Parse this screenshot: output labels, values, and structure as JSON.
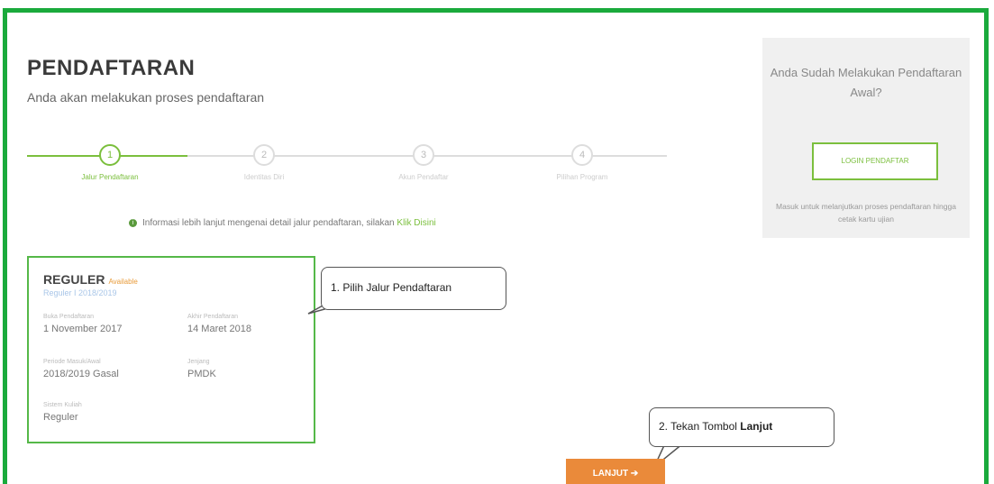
{
  "page": {
    "title": "PENDAFTARAN",
    "subtitle": "Anda akan melakukan proses pendaftaran"
  },
  "steps": [
    {
      "number": "1",
      "label": "Jalur Pendaftaran",
      "active": true
    },
    {
      "number": "2",
      "label": "Identitas Diri",
      "active": false
    },
    {
      "number": "3",
      "label": "Akun Pendaftar",
      "active": false
    },
    {
      "number": "4",
      "label": "Pilihan Program",
      "active": false
    }
  ],
  "info": {
    "text": "Informasi lebih lanjut mengenai detail jalur pendaftaran, silakan",
    "link_label": "Klik Disini"
  },
  "sidebar": {
    "question": "Anda Sudah Melakukan Pendaftaran Awal?",
    "login_button": "LOGIN PENDAFTAR",
    "note": "Masuk untuk melanjutkan proses pendaftaran hingga cetak kartu ujian"
  },
  "card": {
    "name": "REGULER",
    "badge": "Available",
    "period": "Reguler I 2018/2019",
    "fields": [
      {
        "label": "Buka Pendaftaran",
        "value": "1 November 2017"
      },
      {
        "label": "Akhir Pendaftaran",
        "value": "14 Maret 2018"
      },
      {
        "label": "Periode Masuk/Awal",
        "value": "2018/2019 Gasal"
      },
      {
        "label": "Jenjang",
        "value": "PMDK"
      },
      {
        "label": "Sistem Kuliah",
        "value": "Reguler"
      }
    ]
  },
  "callouts": {
    "one": "1. Pilih Jalur Pendaftaran",
    "two_prefix": "2. Tekan Tombol ",
    "two_bold": "Lanjut"
  },
  "actions": {
    "next_button": "LANJUT",
    "next_icon": "arrow-right-icon"
  },
  "colors": {
    "border": "#1aaa3c",
    "accent_green": "#7bbf3d",
    "button_orange": "#ea8a3a"
  }
}
